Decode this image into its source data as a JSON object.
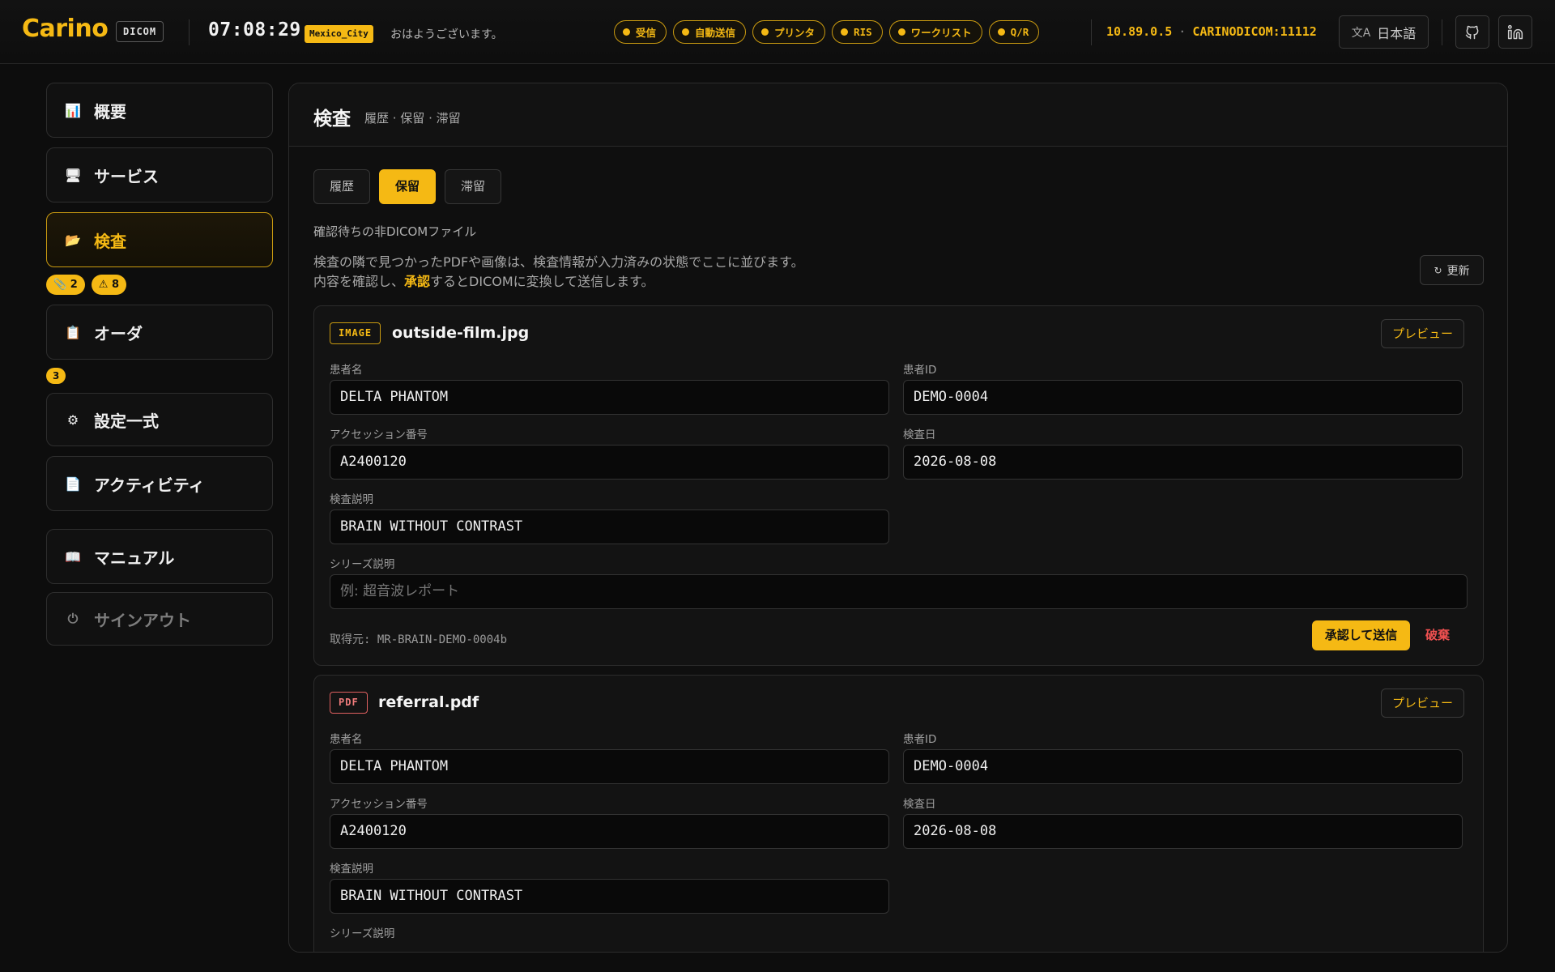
{
  "header": {
    "logo": "Carino",
    "logo_badge": "DICOM",
    "clock": "07:08:29",
    "timezone": "Mexico_City",
    "greeting": "おはようございます。",
    "status_pills": [
      {
        "label": "受信"
      },
      {
        "label": "自動送信"
      },
      {
        "label": "プリンタ"
      },
      {
        "label": "RIS"
      },
      {
        "label": "ワークリスト"
      },
      {
        "label": "Q/R"
      }
    ],
    "ip": "10.89.0.5",
    "separator": "·",
    "ae_port": "CARINODICOM:11112",
    "language": "日本語",
    "accent_color": "#f5b914"
  },
  "sidebar": {
    "items": [
      {
        "label": "概要",
        "icon": "chart-icon"
      },
      {
        "label": "サービス",
        "icon": "monitor-icon"
      },
      {
        "label": "検査",
        "icon": "folder-icon"
      },
      {
        "label": "オーダ",
        "icon": "clipboard-icon"
      },
      {
        "label": "設定一式",
        "icon": "gear-icon"
      },
      {
        "label": "アクティビティ",
        "icon": "document-icon"
      },
      {
        "label": "マニュアル",
        "icon": "book-icon"
      },
      {
        "label": "サインアウト",
        "icon": "power-icon"
      }
    ],
    "study_badges": [
      {
        "icon": "📎",
        "count": "2"
      },
      {
        "icon": "⚠",
        "count": "8"
      }
    ],
    "order_badge": "3"
  },
  "main": {
    "title": "検査",
    "subtitle": "履歴 · 保留 · 滞留",
    "tabs": [
      {
        "label": "履歴",
        "active": false
      },
      {
        "label": "保留",
        "active": true
      },
      {
        "label": "滞留",
        "active": false
      }
    ],
    "section_label": "確認待ちの非DICOMファイル",
    "description_before": "検査の隣で見つかったPDFや画像は、検査情報が入力済みの状態でここに並びます。内容を確認し、",
    "description_highlight": "承認",
    "description_after": "するとDICOMに変換して送信します。",
    "refresh_label": "更新",
    "field_labels": {
      "patient_name": "患者名",
      "patient_id": "患者ID",
      "accession": "アクセッション番号",
      "study_date": "検査日",
      "study_description": "検査説明",
      "series_description": "シリーズ説明"
    },
    "preview_label": "プレビュー",
    "approve_label": "承認して送信",
    "discard_label": "破棄",
    "cards": [
      {
        "type": "IMAGE",
        "filename": "outside-film.jpg",
        "patient_name": "DELTA PHANTOM",
        "patient_id": "DEMO-0004",
        "accession": "A2400120",
        "study_date": "2026-08-08",
        "study_description": "BRAIN WITHOUT CONTRAST",
        "series_placeholder": "例: 超音波レポート",
        "source": "取得元: MR-BRAIN-DEMO-0004b"
      },
      {
        "type": "PDF",
        "filename": "referral.pdf",
        "patient_name": "DELTA PHANTOM",
        "patient_id": "DEMO-0004",
        "accession": "A2400120",
        "study_date": "2026-08-08",
        "study_description": "BRAIN WITHOUT CONTRAST"
      }
    ]
  }
}
